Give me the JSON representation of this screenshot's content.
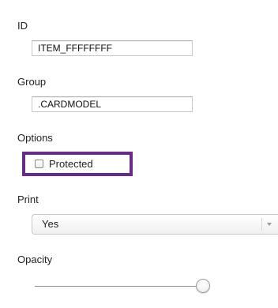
{
  "inspector": {
    "id_section": {
      "label": "ID",
      "value": "ITEM_FFFFFFFF"
    },
    "group_section": {
      "label": "Group",
      "value": ".CARDMODEL"
    },
    "options_section": {
      "label": "Options",
      "protected": {
        "label": "Protected",
        "checked": false
      }
    },
    "print_section": {
      "label": "Print",
      "selected": "Yes"
    },
    "opacity_section": {
      "label": "Opacity",
      "level_percent": 100
    }
  },
  "colors": {
    "highlight_border": "#6a2a8c",
    "field_border": "#c9c9c9"
  }
}
